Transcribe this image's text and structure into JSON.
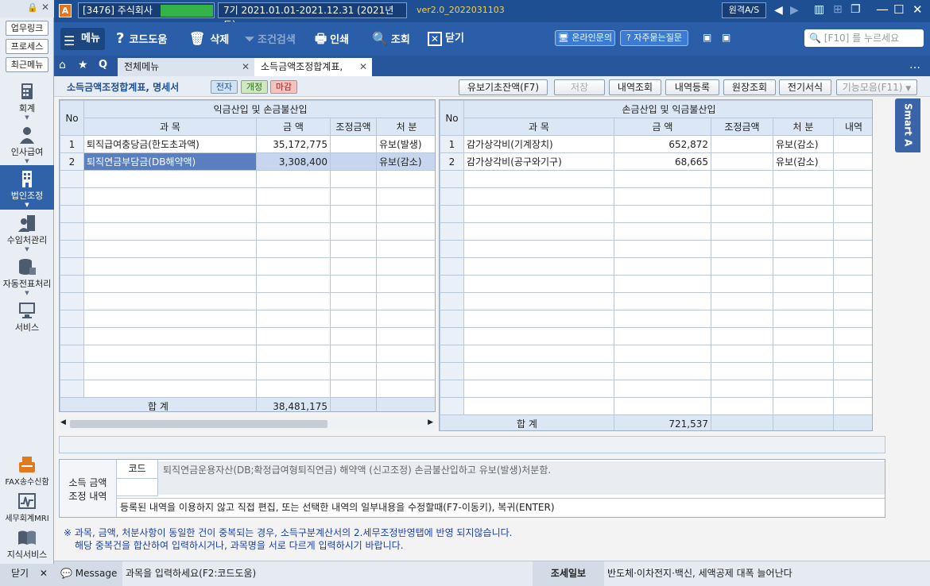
{
  "sidebar": {
    "links": [
      "업무링크",
      "프로세스",
      "최근메뉴"
    ],
    "items": [
      {
        "label": "회계",
        "icon": "calculator-icon"
      },
      {
        "label": "인사급여",
        "icon": "person-icon"
      },
      {
        "label": "법인조정",
        "icon": "building-icon"
      },
      {
        "label": "수임처관리",
        "icon": "people-icon"
      },
      {
        "label": "자동전표처리",
        "icon": "database-icon"
      },
      {
        "label": "서비스",
        "icon": "monitor-icon"
      }
    ],
    "bottom_items": [
      {
        "label": "FAX송수신함",
        "icon": "fax-icon"
      },
      {
        "label": "세무회계MRI",
        "icon": "chart-icon"
      },
      {
        "label": "지식서비스",
        "icon": "book-icon"
      }
    ],
    "close_label": "닫기"
  },
  "titlebar": {
    "company": "[3476] 주식회사",
    "period": "7기  2021.01.01-2021.12.31  (2021년도)",
    "version": "ver2.0_2022031103",
    "remote": "원격A/S"
  },
  "toolbar": {
    "menu": "메뉴",
    "code_help": "코드도움",
    "delete": "삭제",
    "filter": "조건검색",
    "print": "인쇄",
    "search": "조회",
    "close": "닫기",
    "online_inquiry": "온라인문의",
    "faq": "자주묻는질문",
    "search_placeholder": "[F10] 를 누르세요"
  },
  "tabs": {
    "all_menu": "전체메뉴",
    "current": "소득금액조정합계표,"
  },
  "subbar": {
    "title": "소득금액조정합계표, 명세서",
    "tag_electronic": "전자",
    "tag_revised": "개정",
    "tag_deadline": "마감",
    "buttons": [
      "유보기초잔액(F7)",
      "저장",
      "내역조회",
      "내역등록",
      "원장조회",
      "전기서식",
      "기능모음(F11)"
    ]
  },
  "left_table": {
    "group_header": "익금산입 및 손금불산입",
    "headers": [
      "No",
      "과  목",
      "금  액",
      "조정금액",
      "처  분"
    ],
    "rows": [
      {
        "no": "1",
        "item": "퇴직급여충당금(한도초과액)",
        "amount": "35,172,775",
        "adj": "",
        "disp": "유보(발생)"
      },
      {
        "no": "2",
        "item": "퇴직연금부담금(DB해약액)",
        "amount": "3,308,400",
        "adj": "",
        "disp": "유보(감소)"
      }
    ],
    "total_label": "합 계",
    "total_amount": "38,481,175"
  },
  "right_table": {
    "group_header": "손금산입 및 익금불산입",
    "headers": [
      "No",
      "과  목",
      "금  액",
      "조정금액",
      "처  분",
      "내역"
    ],
    "rows": [
      {
        "no": "1",
        "item": "감가상각비(기계장치)",
        "amount": "652,872",
        "adj": "",
        "disp": "유보(감소)",
        "note": ""
      },
      {
        "no": "2",
        "item": "감가상각비(공구와기구)",
        "amount": "68,665",
        "adj": "",
        "disp": "유보(감소)",
        "note": ""
      }
    ],
    "total_label": "합 계",
    "total_amount": "721,537"
  },
  "info": {
    "label": "소득 금액 조정 내역",
    "code_label": "코드",
    "code_text": "퇴직연금운용자산(DB;확정급여형퇴직연금) 해약액 (신고조정) 손금불산입하고 유보(발생)처분함.",
    "edit_hint": "등록된 내역을 이용하지 않고 직접 편집, 또는 선택한 내역의 일부내용을 수정할때(F7-이동키), 복귀(ENTER)"
  },
  "notice": {
    "line1": "※ 과목, 금액, 처분사항이 동일한 건이 중복되는 경우, 소득구분계산서의 2.세무조정반영탭에 반영 되지않습니다.",
    "line2": "해당 중복건을 합산하여 입력하시거나, 과목명을 서로 다르게 입력하시기 바랍니다."
  },
  "smart": "Smart A",
  "status": {
    "message_label": "Message",
    "message_text": "과목을 입력하세요(F2:코드도움)",
    "news_label": "조세일보",
    "news_text": "반도체·이차전지·백신, 세액공제 대폭 늘어난다"
  },
  "colors": {
    "brand": "#1f4f93",
    "selection": "#5a7fc0",
    "grid_border": "#b9c7d8",
    "green_bar": "#35b24a"
  }
}
